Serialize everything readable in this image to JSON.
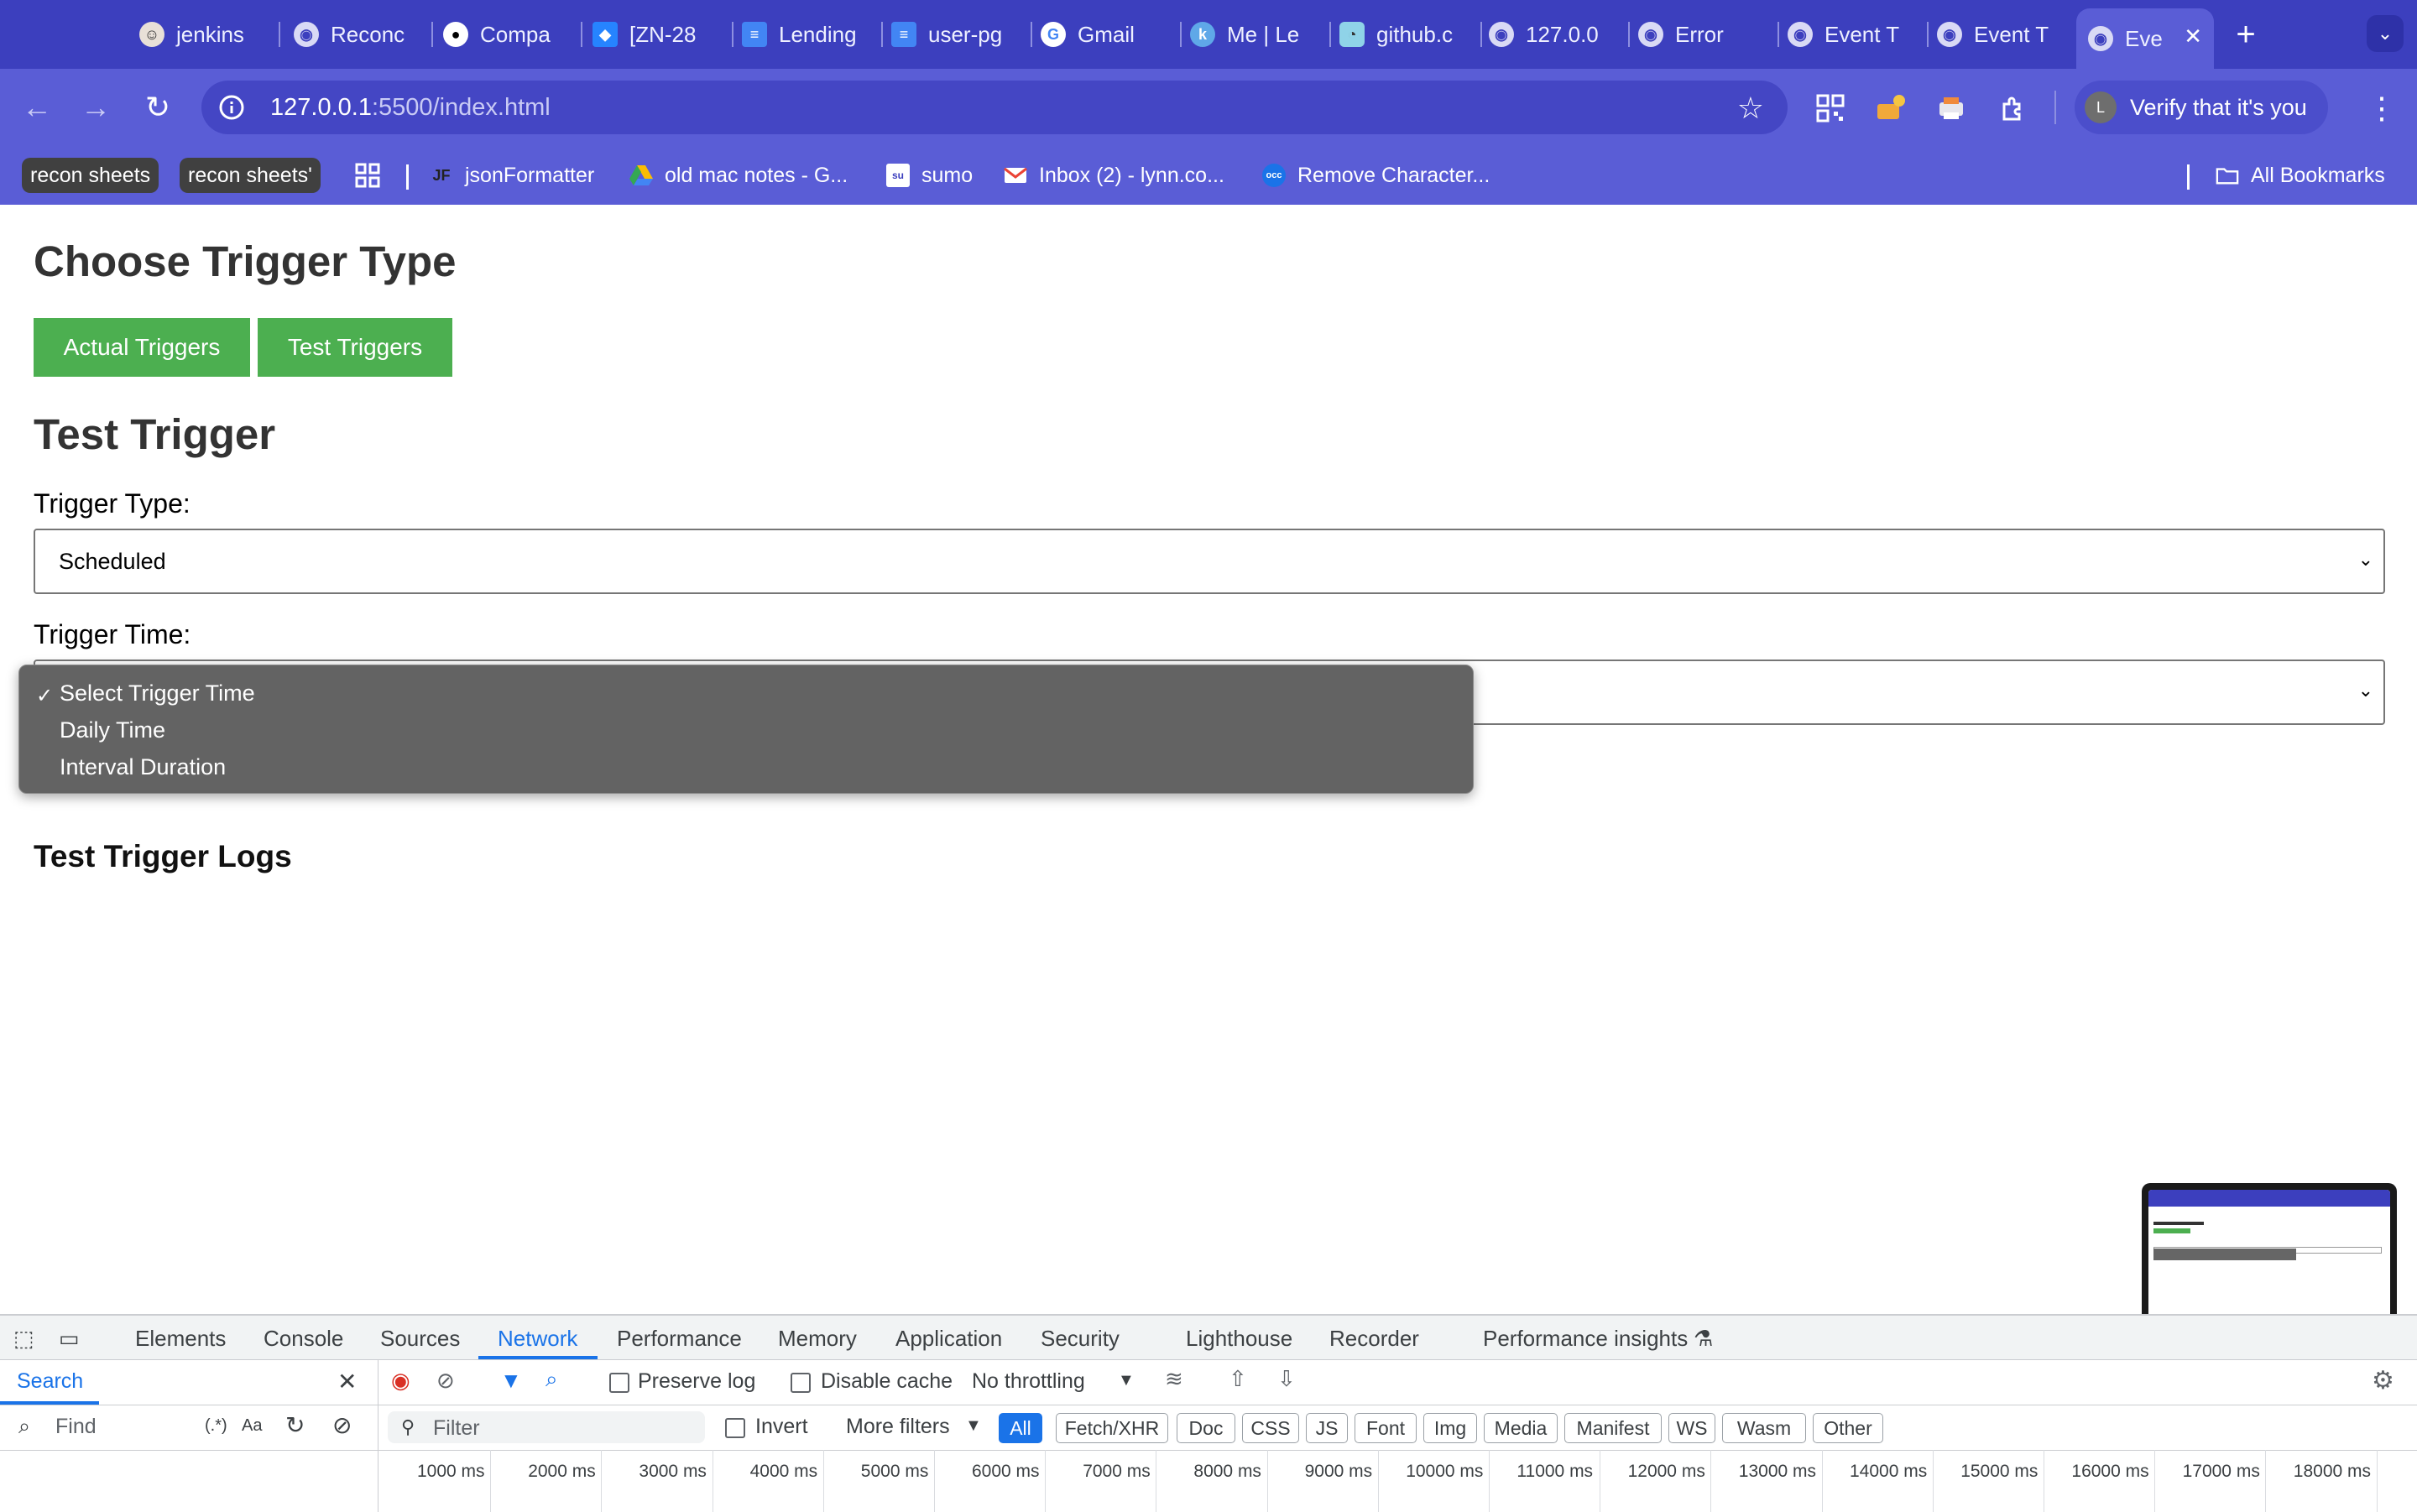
{
  "browser": {
    "tabs": [
      {
        "title": "jenkins",
        "icon": "jenkins-icon"
      },
      {
        "title": "Reconc",
        "icon": "globe-icon"
      },
      {
        "title": "Compa",
        "icon": "github-icon"
      },
      {
        "title": "[ZN-28",
        "icon": "jira-icon"
      },
      {
        "title": "Lending",
        "icon": "docs-icon"
      },
      {
        "title": "user-pg",
        "icon": "docs-icon"
      },
      {
        "title": "Gmail",
        "icon": "google-icon"
      },
      {
        "title": "Me | Le",
        "icon": "k-icon"
      },
      {
        "title": "github.c",
        "icon": "gopher-icon"
      },
      {
        "title": "127.0.0",
        "icon": "globe-icon"
      },
      {
        "title": "Error",
        "icon": "globe-icon"
      },
      {
        "title": "Event T",
        "icon": "globe-icon"
      },
      {
        "title": "Event T",
        "icon": "globe-icon"
      },
      {
        "title": "Eve",
        "icon": "globe-icon"
      }
    ],
    "url_host": "127.0.0.1",
    "url_path": ":5500/index.html",
    "profile_label": "Verify that it's you",
    "profile_initial": "L",
    "bookmarks": [
      {
        "label": "recon sheets"
      },
      {
        "label": "recon sheets'"
      },
      {
        "label": "jsonFormatter"
      },
      {
        "label": "old mac notes - G..."
      },
      {
        "label": "sumo"
      },
      {
        "label": "Inbox (2) - lynn.co..."
      },
      {
        "label": "Remove Character..."
      }
    ],
    "all_bookmarks": "All Bookmarks"
  },
  "page": {
    "heading": "Choose Trigger Type",
    "buttons": {
      "actual": "Actual Triggers",
      "test": "Test Triggers"
    },
    "section_title": "Test Trigger",
    "trigger_type_label": "Trigger Type:",
    "trigger_type_value": "Scheduled",
    "trigger_time_label": "Trigger Time:",
    "dropdown_options": [
      "Select Trigger Time",
      "Daily Time",
      "Interval Duration"
    ],
    "selected_option": "Select Trigger Time",
    "logs_title": "Test Trigger Logs"
  },
  "devtools": {
    "tabs": [
      "Elements",
      "Console",
      "Sources",
      "Network",
      "Performance",
      "Memory",
      "Application",
      "Security",
      "Lighthouse",
      "Recorder",
      "Performance insights"
    ],
    "active_tab": "Network",
    "search_label": "Search",
    "find_placeholder": "Find",
    "regex_label": "(.*)",
    "case_label": "Aa",
    "preserve_log": "Preserve log",
    "disable_cache": "Disable cache",
    "throttling": "No throttling",
    "filter_placeholder": "Filter",
    "invert": "Invert",
    "more_filters": "More filters",
    "type_filters": [
      "All",
      "Fetch/XHR",
      "Doc",
      "CSS",
      "JS",
      "Font",
      "Img",
      "Media",
      "Manifest",
      "WS",
      "Wasm",
      "Other"
    ],
    "timeline_ticks": [
      "1000 ms",
      "2000 ms",
      "3000 ms",
      "4000 ms",
      "5000 ms",
      "6000 ms",
      "7000 ms",
      "8000 ms",
      "9000 ms",
      "10000 ms",
      "11000 ms",
      "12000 ms",
      "13000 ms",
      "14000 ms",
      "15000 ms",
      "16000 ms",
      "17000 ms",
      "18000 ms"
    ]
  }
}
